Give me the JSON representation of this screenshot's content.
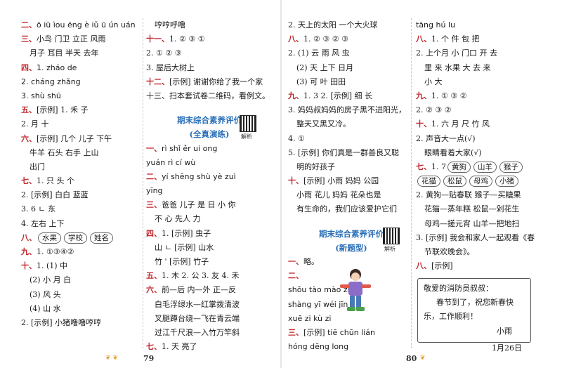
{
  "page_left": "79",
  "page_right": "80",
  "qr_caption": "解析",
  "col1": [
    {
      "sec": "二、",
      "text": "ō iū  ìou  ēng è  iǔ ū  ún uán",
      "py": true
    },
    {
      "sec": "三、",
      "text": "小鸟  门卫  立正  风雨"
    },
    {
      "sec": "",
      "text": "月子  耳目  半天  去年",
      "indent": true
    },
    {
      "sec": "四、",
      "text": "1. zháo  de",
      "py": true
    },
    {
      "sec": "",
      "text": "2. cháng  zhǎng",
      "py": true
    },
    {
      "sec": "",
      "text": "3. shù  shū",
      "py": true
    },
    {
      "sec": "五、",
      "text": "[示例] 1. 禾  子"
    },
    {
      "sec": "",
      "text": "2. 月  十"
    },
    {
      "sec": "六、",
      "text": "[示例] 几个  儿子  下午"
    },
    {
      "sec": "",
      "text": "牛羊  石头  右手  上山",
      "indent": true
    },
    {
      "sec": "",
      "text": "出门",
      "indent": true
    },
    {
      "sec": "七、",
      "text": "1. 只  头  个"
    },
    {
      "sec": "",
      "text": "2. [示例] 白白  蓝蓝"
    },
    {
      "sec": "",
      "text": "3. 6  ㄴ  东"
    },
    {
      "sec": "",
      "text": "4. 左右  上下"
    },
    {
      "sec": "八、",
      "boxes": [
        "水果",
        "学校",
        "姓名"
      ]
    },
    {
      "sec": "九、",
      "text": "1. ①③④②"
    },
    {
      "sec": "十、",
      "text": "1. (1) 中"
    },
    {
      "sec": "",
      "text": "(2) 小  月  白",
      "indent": true
    },
    {
      "sec": "",
      "text": "(3) 风  头",
      "indent": true
    },
    {
      "sec": "",
      "text": "(4) 山  水",
      "indent": true
    },
    {
      "sec": "",
      "text": "2. [示例] 小猪噜噜哼哼"
    }
  ],
  "col2_top": [
    {
      "sec": "",
      "text": "哼哼呼噜",
      "indent": true
    },
    {
      "sec": "十一、",
      "text": "1. ②  ③  ①"
    },
    {
      "sec": "",
      "text": "2. ①  ②  ③"
    },
    {
      "sec": "",
      "text": "3. 屋后大树上"
    },
    {
      "sec": "十二、",
      "text": "[示例] 谢谢你给了我一个家"
    },
    {
      "sec": "",
      "text": "十三、扫本套试卷二维码，看例文。"
    }
  ],
  "col2_title1": "期末综合素养评价",
  "col2_title2": "(全真演练)",
  "col2_bottom": [
    {
      "sec": "一、",
      "text": "rì shǐ  ěr ui ong",
      "py": true
    },
    {
      "sec": "",
      "text": "yuán rì cí wù",
      "py": true
    },
    {
      "sec": "二、",
      "text": "yí  shēng  shù  yè  zuì",
      "py": true
    },
    {
      "sec": "",
      "text": "yīng",
      "py": true
    },
    {
      "sec": "三、",
      "text": "爸爸  儿子  是  日  小  你"
    },
    {
      "sec": "",
      "text": "不  心  先人  力",
      "indent": true
    },
    {
      "sec": "四、",
      "text": "1. [示例] 虫子"
    },
    {
      "sec": "",
      "text": "山  ㄴ  [示例] 山水",
      "indent": true
    },
    {
      "sec": "",
      "text": "竹  ' [示例] 竹子",
      "indent": true
    },
    {
      "sec": "五、",
      "text": "1. 木  2. 公  3. 友  4. 禾"
    },
    {
      "sec": "六、",
      "text": "前—后  内—外  正—反"
    },
    {
      "sec": "",
      "text": "白毛浮绿水—红掌拨清波",
      "indent": true
    },
    {
      "sec": "",
      "text": "叉腿蹲台绕—飞在青云端",
      "indent": true
    },
    {
      "sec": "",
      "text": "过江千尺浪—入竹万竿斜",
      "indent": true
    },
    {
      "sec": "七、",
      "text": "1. 天  亮了"
    }
  ],
  "col3_top": [
    {
      "sec": "",
      "text": "2. 天上的太阳  一个大火球"
    },
    {
      "sec": "八、",
      "text": "1. ②  ③  ②  ③"
    },
    {
      "sec": "",
      "text": "2. (1) 云  雨  风  虫"
    },
    {
      "sec": "",
      "text": "(2) 天  上下  日月",
      "indent": true
    },
    {
      "sec": "",
      "text": "(3) 可  叶  田田",
      "indent": true
    },
    {
      "sec": "九、",
      "text": "1. 3  2. [示例] 细  长"
    },
    {
      "sec": "",
      "text": "3. 妈妈叔妈妈的房子黑不进阳光，"
    },
    {
      "sec": "",
      "text": "整天又黑又冷。",
      "indent": true
    },
    {
      "sec": "",
      "text": "4. ①"
    },
    {
      "sec": "",
      "text": "5. [示例] 你们真是一群善良又聪"
    },
    {
      "sec": "",
      "text": "明的好孩子",
      "indent": true
    },
    {
      "sec": "十、",
      "text": "[示例] 小雨  妈妈  公园"
    },
    {
      "sec": "",
      "text": "小雨  花儿  妈妈  花朵也是",
      "indent": true
    },
    {
      "sec": "",
      "text": "有生命的，我们应该爱护它们",
      "indent": true
    }
  ],
  "col3_title1": "期末综合素养评价",
  "col3_title2": "(新题型)",
  "col3_bottom": [
    {
      "sec": "一、",
      "text": "略。"
    },
    {
      "sec": "二、",
      "text": ""
    },
    {
      "sec": "",
      "text": "shǒu tào                  mào zi",
      "py": true
    },
    {
      "sec": "",
      "text": "shàng yī                  wéi jīn",
      "py": true
    },
    {
      "sec": "",
      "text": "xuē zi                    kù zi",
      "py": true
    },
    {
      "sec": "三、",
      "text": "[示例] tiē chūn lián",
      "py": true
    },
    {
      "sec": "",
      "text": "hóng dēng long",
      "py": true
    }
  ],
  "col4": [
    {
      "sec": "",
      "text": "tāng hú lu",
      "py": true
    },
    {
      "sec": "八、",
      "text": "1. 个  件  包  把"
    },
    {
      "sec": "",
      "text": "2. 上个月  小  门口  开  去"
    },
    {
      "sec": "",
      "text": "里  来  水果  大  去  来",
      "indent": true
    },
    {
      "sec": "",
      "text": "小  大",
      "indent": true
    },
    {
      "sec": "九、",
      "text": "1. ①  ③  ②"
    },
    {
      "sec": "",
      "text": "2. ②  ③  ②"
    },
    {
      "sec": "十、",
      "text": "1. 六  月  尺  竹  风"
    },
    {
      "sec": "",
      "text": "2. 声音大一点(√)"
    },
    {
      "sec": "",
      "text": "眼睛看着大家(√)",
      "indent": true
    },
    {
      "sec": "七、",
      "text": "1. 7",
      "boxes": [
        "黄狗",
        "山羊",
        "猴子"
      ]
    },
    {
      "sec": "",
      "boxes": [
        "花猫",
        "松鼠",
        "母鸡",
        "小猪"
      ]
    },
    {
      "sec": "",
      "text": "2. 黄狗—贴春联  猴子—买糖果"
    },
    {
      "sec": "",
      "text": "花猫—蒸年糕  松鼠—剁花生",
      "indent": true
    },
    {
      "sec": "",
      "text": "母鸡—搓元宵  山羊—把地扫",
      "indent": true
    },
    {
      "sec": "",
      "text": "3. [示例] 我会和家人一起观看《春"
    },
    {
      "sec": "",
      "text": "节联欢晚会》。",
      "indent": true
    },
    {
      "sec": "八、",
      "text": "[示例]"
    }
  ],
  "letter": {
    "greeting": "敬爱的消防员叔叔：",
    "body1": "春节到了，祝您新春快",
    "body2": "乐，工作顺利！",
    "signature": "小雨",
    "date": "1月26日"
  }
}
